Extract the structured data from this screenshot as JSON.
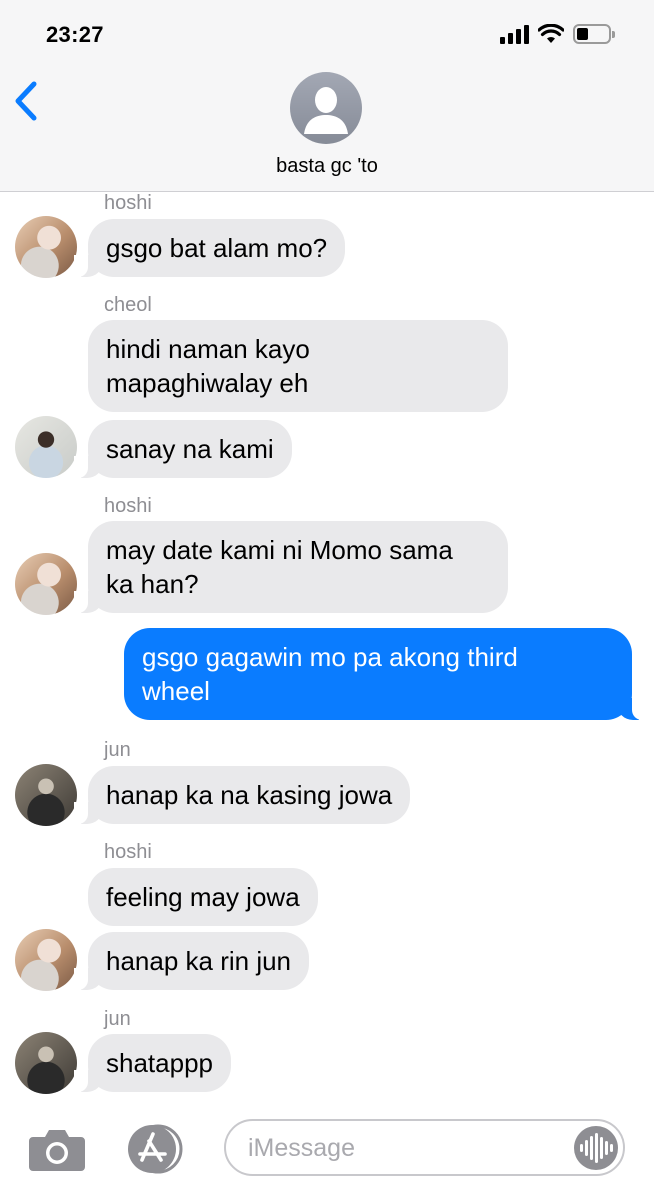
{
  "status_bar": {
    "time": "23:27",
    "signal_bars": 4,
    "battery_level": 0.35
  },
  "header": {
    "conversation_name": "basta gc 'to",
    "back_icon": "chevron-left-icon",
    "avatar_icon": "person-silhouette-icon"
  },
  "messages": [
    {
      "sender": "hoshi",
      "text": "gsgo bat alam mo?"
    },
    {
      "sender": "cheol",
      "text_lines": [
        "hindi naman kayo",
        "mapaghiwalay eh"
      ]
    },
    {
      "text": "sanay na kami"
    },
    {
      "sender": "hoshi",
      "text_lines": [
        "may date kami ni Momo sama",
        "ka han?"
      ]
    },
    {
      "from_me": true,
      "text_lines": [
        "gsgo gagawin mo pa akong third",
        "wheel"
      ]
    },
    {
      "sender": "jun",
      "text": "hanap ka na kasing jowa"
    },
    {
      "sender": "hoshi",
      "text": "feeling may jowa"
    },
    {
      "text": "hanap ka rin jun"
    },
    {
      "sender": "jun",
      "text": "shatappp"
    }
  ],
  "input_bar": {
    "placeholder": "iMessage",
    "camera_icon": "camera-icon",
    "apps_icon": "app-store-icon",
    "audio_icon": "audio-waveform-icon"
  },
  "colors": {
    "outgoing_bubble": "#0a7cff",
    "incoming_bubble": "#e9e9eb",
    "accent": "#0a7cff"
  }
}
